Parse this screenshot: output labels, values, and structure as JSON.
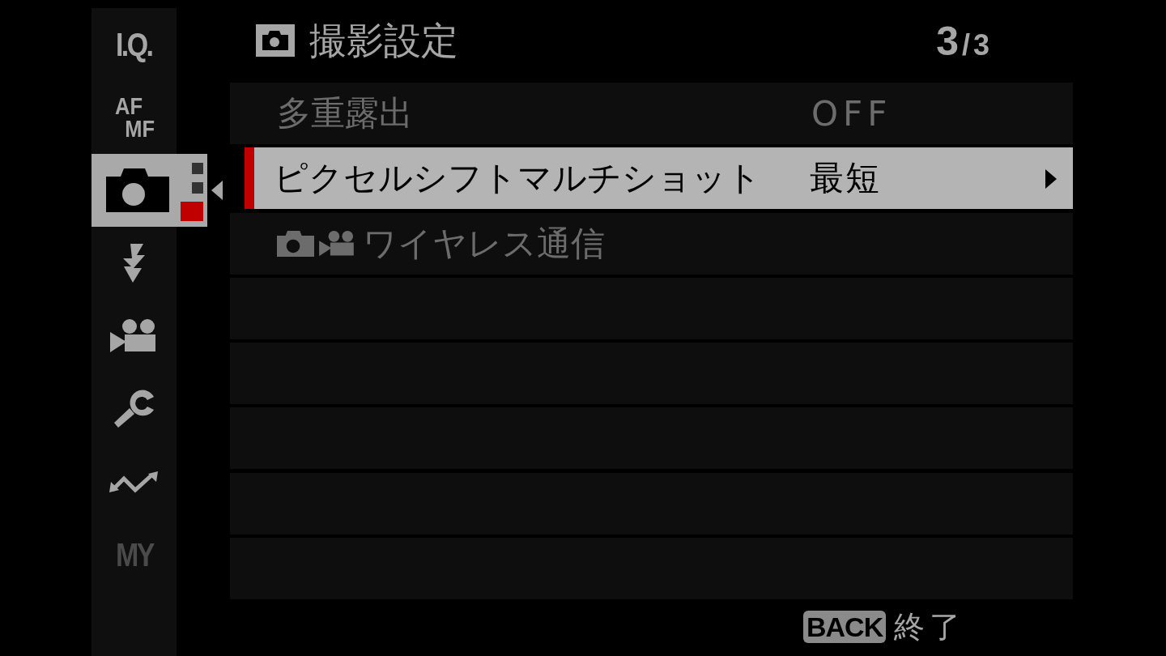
{
  "sidebar": {
    "items": [
      {
        "kind": "text",
        "lines": [
          "I.Q."
        ],
        "selected": false,
        "disabled": false
      },
      {
        "kind": "text",
        "lines": [
          "AF",
          "MF"
        ],
        "selected": false,
        "disabled": false
      },
      {
        "kind": "camera",
        "selected": true,
        "disabled": false,
        "pages": [
          {
            "selected": false
          },
          {
            "selected": false
          },
          {
            "selected": true
          }
        ]
      },
      {
        "kind": "flash",
        "selected": false,
        "disabled": false
      },
      {
        "kind": "movie",
        "selected": false,
        "disabled": false
      },
      {
        "kind": "wrench",
        "selected": false,
        "disabled": false
      },
      {
        "kind": "network",
        "selected": false,
        "disabled": false
      },
      {
        "kind": "text",
        "lines": [
          "MY"
        ],
        "selected": false,
        "disabled": true
      }
    ]
  },
  "header": {
    "title": "撮影設定",
    "page": {
      "current": "3",
      "separator": "/",
      "total": "3"
    }
  },
  "rows": [
    {
      "kind": "plain",
      "label": "多重露出",
      "value": "OFF",
      "selected": false,
      "disabled": true
    },
    {
      "kind": "plain",
      "label": "ピクセルシフトマルチショット",
      "value": "最短",
      "selected": true,
      "disabled": false,
      "submenu": true
    },
    {
      "kind": "still-movie",
      "label": "ワイヤレス通信",
      "selected": false,
      "disabled": true
    }
  ],
  "footer": {
    "key": "BACK",
    "action": "終了"
  }
}
